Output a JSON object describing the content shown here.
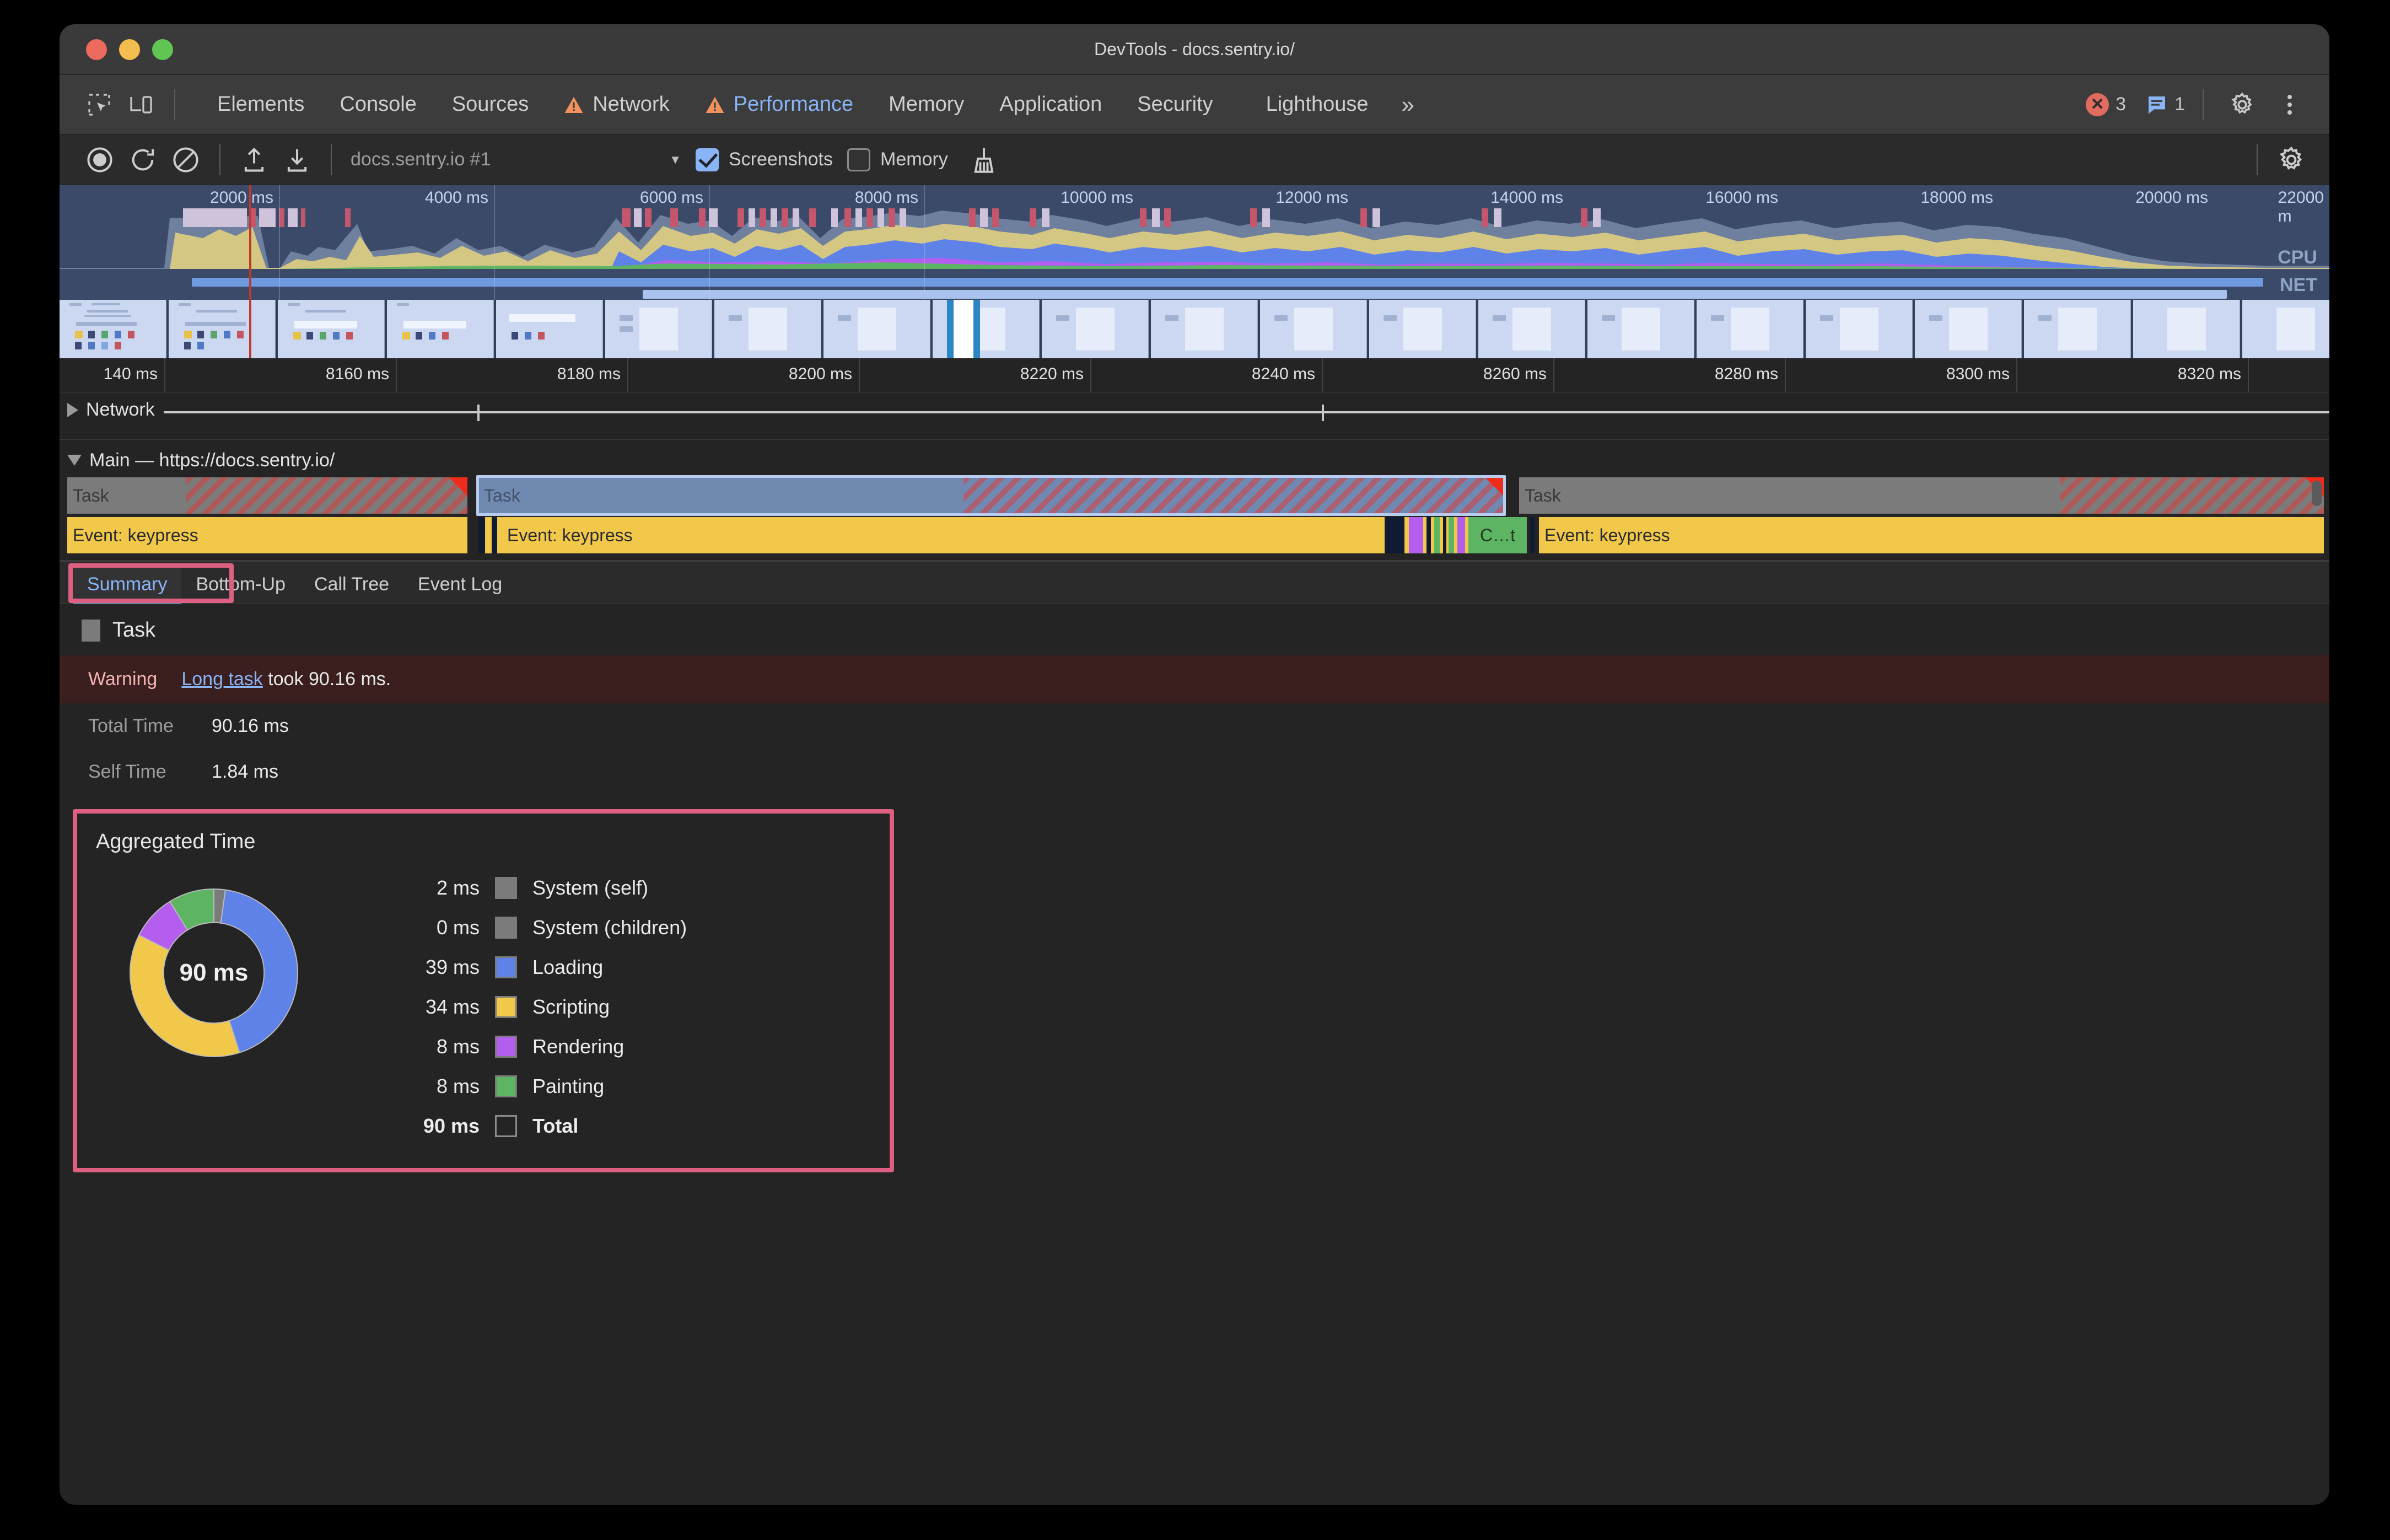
{
  "window": {
    "title": "DevTools - docs.sentry.io/"
  },
  "tabbar": {
    "tabs": [
      {
        "label": "Elements",
        "active": false,
        "warn": false
      },
      {
        "label": "Console",
        "active": false,
        "warn": false
      },
      {
        "label": "Sources",
        "active": false,
        "warn": false
      },
      {
        "label": "Network",
        "active": false,
        "warn": true
      },
      {
        "label": "Performance",
        "active": true,
        "warn": true
      },
      {
        "label": "Memory",
        "active": false,
        "warn": false
      },
      {
        "label": "Application",
        "active": false,
        "warn": false
      },
      {
        "label": "Security",
        "active": false,
        "warn": false
      },
      {
        "label": "Lighthouse",
        "active": false,
        "warn": false
      }
    ],
    "more_label": "»",
    "error_count": "3",
    "error_mark": "✕",
    "message_count": "1",
    "settings_icon": "gear-icon",
    "more_icon": "kebab-menu-icon"
  },
  "perfbar": {
    "record_icon": "record-icon",
    "reload_icon": "reload-record-icon",
    "clear_icon": "clear-icon",
    "upload_icon": "upload-profile-icon",
    "download_icon": "download-profile-icon",
    "profile_name": "docs.sentry.io #1",
    "screenshots_label": "Screenshots",
    "screenshots_checked": true,
    "memory_label": "Memory",
    "memory_checked": false,
    "collect_garbage_icon": "broom-icon",
    "capture_settings_icon": "gear-icon"
  },
  "overview": {
    "cpu_label": "CPU",
    "net_label": "NET",
    "ticks": [
      "2000 ms",
      "4000 ms",
      "6000 ms",
      "8000 ms",
      "10000 ms",
      "12000 ms",
      "14000 ms",
      "16000 ms",
      "18000 ms",
      "20000 ms",
      "22000 m"
    ]
  },
  "ruler": {
    "ticks": [
      "140 ms",
      "8160 ms",
      "8180 ms",
      "8200 ms",
      "8220 ms",
      "8240 ms",
      "8260 ms",
      "8280 ms",
      "8300 ms",
      "8320 ms"
    ]
  },
  "tracks": {
    "network_label": "Network",
    "main_label": "Main — https://docs.sentry.io/",
    "task_label": "Task",
    "event_label": "Event: keypress",
    "compile_label": "C…t"
  },
  "detail_tabs": {
    "tabs": [
      "Summary",
      "Bottom-Up",
      "Call Tree",
      "Event Log"
    ],
    "active": "Summary"
  },
  "summary": {
    "event_name": "Task",
    "warning_label": "Warning",
    "warning_link": "Long task",
    "warning_rest": " took 90.16 ms.",
    "total_time_label": "Total Time",
    "total_time_value": "90.16 ms",
    "self_time_label": "Self Time",
    "self_time_value": "1.84 ms"
  },
  "chart_data": {
    "type": "pie",
    "title": "Aggregated Time",
    "center_label": "90 ms",
    "unit": "ms",
    "total_label": "Total",
    "total_value": "90 ms",
    "legend_position": "right",
    "categories": [
      "System (self)",
      "System (children)",
      "Loading",
      "Scripting",
      "Rendering",
      "Painting"
    ],
    "values": [
      2,
      0,
      39,
      34,
      8,
      8
    ],
    "value_labels": [
      "2 ms",
      "0 ms",
      "39 ms",
      "34 ms",
      "8 ms",
      "8 ms"
    ],
    "colors": [
      "#7b7b7b",
      "#7b7b7b",
      "#5e82e8",
      "#f2c84b",
      "#b45ef0",
      "#5db563"
    ]
  },
  "colors": {
    "accent_blue": "#8ab4f8",
    "annotation_pink": "#dd5f82",
    "warning_orange": "#f0915e",
    "error_red": "#e06c5f",
    "overview_bg": "#3a4a68"
  }
}
